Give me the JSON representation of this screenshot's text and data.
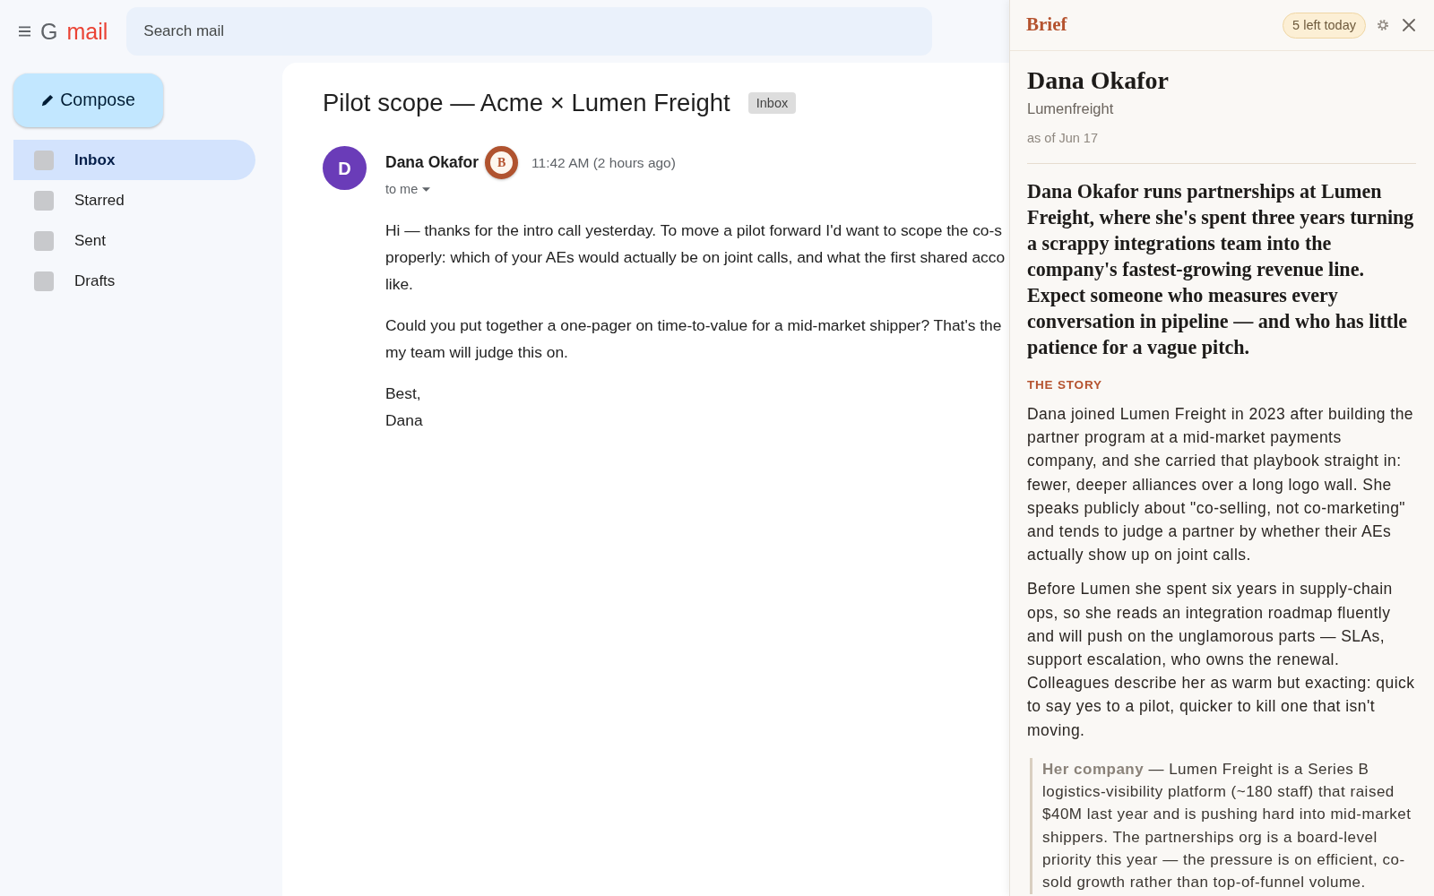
{
  "header": {
    "logo": {
      "letter": "G",
      "wordmark": "mail"
    },
    "search": {
      "placeholder": "Search mail"
    }
  },
  "compose": {
    "label": "Compose"
  },
  "sidebar": {
    "items": [
      {
        "label": "Inbox",
        "selected": true
      },
      {
        "label": "Starred",
        "selected": false
      },
      {
        "label": "Sent",
        "selected": false
      },
      {
        "label": "Drafts",
        "selected": false
      }
    ]
  },
  "email": {
    "subject": "Pilot scope — Acme × Lumen Freight",
    "label": "Inbox",
    "sender": {
      "initial": "D",
      "name": "Dana Okafor",
      "badge": "B",
      "time": "11:42 AM (2 hours ago)",
      "recipient": "to me"
    },
    "paragraphs": [
      {
        "lines": [
          "Hi — thanks for the intro call yesterday. To move a pilot forward I'd want to scope the co-s",
          "properly: which of your AEs would actually be on joint calls, and what the first shared acco",
          "like."
        ]
      },
      {
        "lines": [
          "Could you put together a one-pager on time-to-value for a mid-market shipper? That's the",
          "my team will judge this on."
        ]
      },
      {
        "lines": [
          "Best,",
          "Dana"
        ]
      }
    ]
  },
  "brief": {
    "title": "Brief",
    "quota": "5 left today",
    "person": {
      "name": "Dana Okafor",
      "company": "Lumenfreight",
      "as_of": "as of Jun 17"
    },
    "summary": "Dana Okafor runs partnerships at Lumen Freight, where she's spent three years turning a scrappy integrations team into the company's fastest-growing revenue line. Expect someone who measures every conversation in pipeline — and who has little patience for a vague pitch.",
    "story": {
      "heading": "THE STORY",
      "paragraphs": [
        "Dana joined Lumen Freight in 2023 after building the partner program at a mid-market payments company, and she carried that playbook straight in: fewer, deeper alliances over a long logo wall. She speaks publicly about \"co-selling, not co-marketing\" and tends to judge a partner by whether their AEs actually show up on joint calls.",
        "Before Lumen she spent six years in supply-chain ops, so she reads an integration roadmap fluently and will push on the unglamorous parts — SLAs, support escalation, who owns the renewal. Colleagues describe her as warm but exacting: quick to say yes to a pilot, quicker to kill one that isn't moving."
      ]
    },
    "company_note": "**Her company** — Lumen Freight is a Series B logistics-visibility platform (~180 staff) that raised $40M last year and is pushing hard into mid-market shippers. The partnerships org is a board-level priority this year — the pressure is on efficient, co-sold growth rather than top-of-funnel volume."
  }
}
